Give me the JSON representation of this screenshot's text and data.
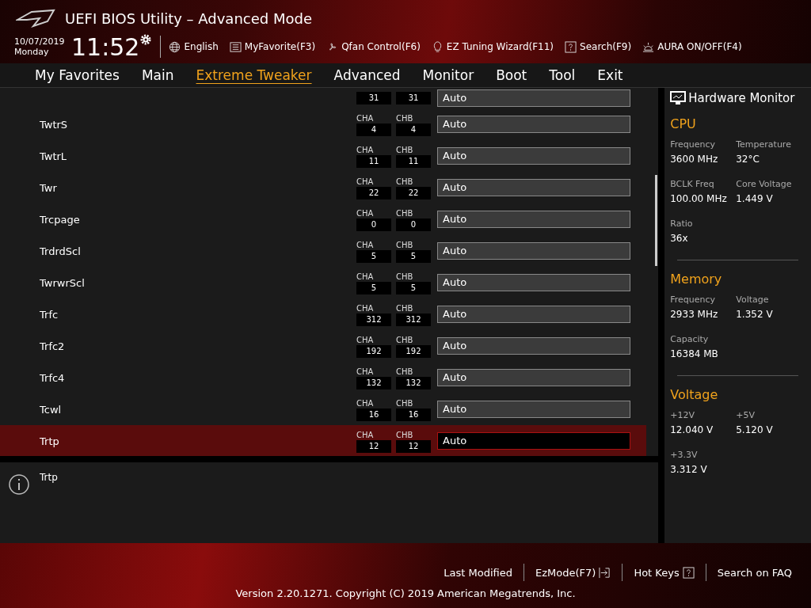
{
  "header": {
    "title": "UEFI BIOS Utility – Advanced Mode",
    "date": "10/07/2019",
    "day": "Monday",
    "time": "11:52",
    "tools": [
      {
        "label": "English"
      },
      {
        "label": "MyFavorite(F3)"
      },
      {
        "label": "Qfan Control(F6)"
      },
      {
        "label": "EZ Tuning Wizard(F11)"
      },
      {
        "label": "Search(F9)"
      },
      {
        "label": "AURA ON/OFF(F4)"
      }
    ]
  },
  "tabs": [
    {
      "label": "My Favorites",
      "selected": false
    },
    {
      "label": "Main",
      "selected": false
    },
    {
      "label": "Extreme Tweaker",
      "selected": true
    },
    {
      "label": "Advanced",
      "selected": false
    },
    {
      "label": "Monitor",
      "selected": false
    },
    {
      "label": "Boot",
      "selected": false
    },
    {
      "label": "Tool",
      "selected": false
    },
    {
      "label": "Exit",
      "selected": false
    }
  ],
  "settings": [
    {
      "kind": "partial",
      "cha": "31",
      "chb": "31",
      "value": "Auto",
      "selected": false
    },
    {
      "kind": "full",
      "name": "TwtrS",
      "cha_label": "CHA",
      "cha": "4",
      "chb_label": "CHB",
      "chb": "4",
      "value": "Auto",
      "selected": false
    },
    {
      "kind": "full",
      "name": "TwtrL",
      "cha_label": "CHA",
      "cha": "11",
      "chb_label": "CHB",
      "chb": "11",
      "value": "Auto",
      "selected": false
    },
    {
      "kind": "full",
      "name": "Twr",
      "cha_label": "CHA",
      "cha": "22",
      "chb_label": "CHB",
      "chb": "22",
      "value": "Auto",
      "selected": false
    },
    {
      "kind": "full",
      "name": "Trcpage",
      "cha_label": "CHA",
      "cha": "0",
      "chb_label": "CHB",
      "chb": "0",
      "value": "Auto",
      "selected": false
    },
    {
      "kind": "full",
      "name": "TrdrdScl",
      "cha_label": "CHA",
      "cha": "5",
      "chb_label": "CHB",
      "chb": "5",
      "value": "Auto",
      "selected": false
    },
    {
      "kind": "full",
      "name": "TwrwrScl",
      "cha_label": "CHA",
      "cha": "5",
      "chb_label": "CHB",
      "chb": "5",
      "value": "Auto",
      "selected": false
    },
    {
      "kind": "full",
      "name": "Trfc",
      "cha_label": "CHA",
      "cha": "312",
      "chb_label": "CHB",
      "chb": "312",
      "value": "Auto",
      "selected": false
    },
    {
      "kind": "full",
      "name": "Trfc2",
      "cha_label": "CHA",
      "cha": "192",
      "chb_label": "CHB",
      "chb": "192",
      "value": "Auto",
      "selected": false
    },
    {
      "kind": "full",
      "name": "Trfc4",
      "cha_label": "CHA",
      "cha": "132",
      "chb_label": "CHB",
      "chb": "132",
      "value": "Auto",
      "selected": false
    },
    {
      "kind": "full",
      "name": "Tcwl",
      "cha_label": "CHA",
      "cha": "16",
      "chb_label": "CHB",
      "chb": "16",
      "value": "Auto",
      "selected": false
    },
    {
      "kind": "full",
      "name": "Trtp",
      "cha_label": "CHA",
      "cha": "12",
      "chb_label": "CHB",
      "chb": "12",
      "value": "Auto",
      "selected": true
    }
  ],
  "help": {
    "text": "Trtp"
  },
  "hardware_monitor": {
    "title": "Hardware Monitor",
    "sections": [
      {
        "title": "CPU",
        "items": [
          {
            "label": "Frequency",
            "value": "3600 MHz"
          },
          {
            "label": "Temperature",
            "value": "32°C"
          },
          {
            "label": "BCLK Freq",
            "value": "100.00 MHz"
          },
          {
            "label": "Core Voltage",
            "value": "1.449 V"
          },
          {
            "label": "Ratio",
            "value": "36x"
          }
        ]
      },
      {
        "title": "Memory",
        "items": [
          {
            "label": "Frequency",
            "value": "2933 MHz"
          },
          {
            "label": "Voltage",
            "value": "1.352 V"
          },
          {
            "label": "Capacity",
            "value": "16384 MB"
          }
        ]
      },
      {
        "title": "Voltage",
        "items": [
          {
            "label": "+12V",
            "value": "12.040 V"
          },
          {
            "label": "+5V",
            "value": "5.120 V"
          },
          {
            "label": "+3.3V",
            "value": "3.312 V"
          }
        ]
      }
    ]
  },
  "footer": {
    "links": [
      {
        "label": "Last Modified"
      },
      {
        "label": "EzMode(F7)"
      },
      {
        "label": "Hot Keys"
      },
      {
        "label": "Search on FAQ"
      }
    ],
    "version": "Version 2.20.1271. Copyright (C) 2019 American Megatrends, Inc."
  }
}
